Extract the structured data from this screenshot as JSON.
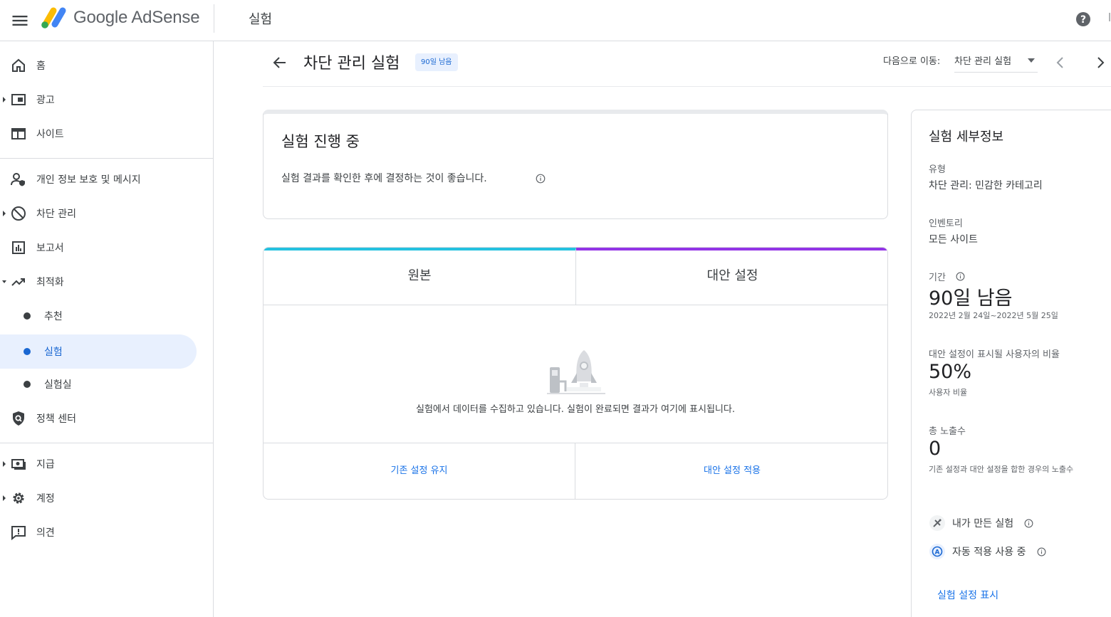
{
  "app": {
    "brand": "Google AdSense",
    "page_title": "실험"
  },
  "sidebar": {
    "items": [
      {
        "label": "홈"
      },
      {
        "label": "광고"
      },
      {
        "label": "사이트"
      },
      {
        "label": "개인 정보 보호 및 메시지"
      },
      {
        "label": "차단 관리"
      },
      {
        "label": "보고서"
      },
      {
        "label": "최적화"
      },
      {
        "label": "추천"
      },
      {
        "label": "실험"
      },
      {
        "label": "실험실"
      },
      {
        "label": "정책 센터"
      },
      {
        "label": "지급"
      },
      {
        "label": "계정"
      },
      {
        "label": "의견"
      }
    ],
    "active_item": "실험"
  },
  "header": {
    "title": "차단 관리 실험",
    "chip": "90일 남음",
    "goto_label": "다음으로 이동:",
    "goto_value": "차단 관리 실험"
  },
  "status": {
    "title": "실험 진행 중",
    "description": "실험 결과를 확인한 후에 결정하는 것이 좋습니다."
  },
  "compare": {
    "original_label": "원본",
    "variant_label": "대안 설정",
    "empty_message": "실험에서 데이터를 수집하고 있습니다. 실험이 완료되면 결과가 여기에 표시됩니다.",
    "keep_original": "기존 설정 유지",
    "apply_variant": "대안 설정 적용",
    "colors": {
      "original": "#24c1e0",
      "variant": "#9334e6"
    }
  },
  "details": {
    "title": "실험 세부정보",
    "type_label": "유형",
    "type_value": "차단 관리: 민감한 카테고리",
    "inventory_label": "인벤토리",
    "inventory_value": "모든 사이트",
    "period_label": "기간",
    "period_value": "90일 남음",
    "period_range": "2022년 2월 24일~2022년 5월 25일",
    "ratio_label": "대안 설정이 표시될 사용자의 비율",
    "ratio_value": "50%",
    "ratio_sub": "사용자 비율",
    "impressions_label": "총 노출수",
    "impressions_value": "0",
    "impressions_sub": "기존 설정과 대안 설정을 합한 경우의 노출수",
    "feature_1": "내가 만든 실험",
    "feature_2": "자동 적용 사용 중",
    "show_settings": "실험 설정 표시"
  }
}
